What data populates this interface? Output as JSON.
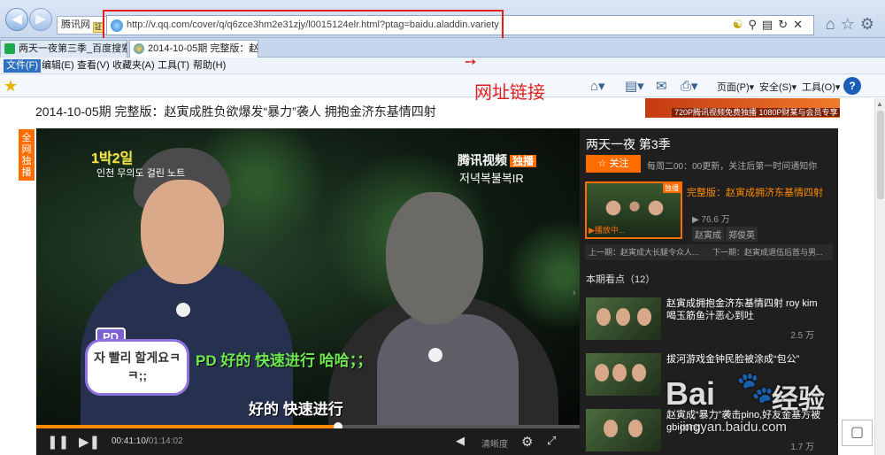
{
  "browser": {
    "site_id": "腾讯网",
    "cert_label": "証",
    "url": "http://v.qq.com/cover/q/q6zce3hm2e31zjy/l0015124elr.html?ptag=baidu.aladdin.variety",
    "tabs": [
      {
        "label": "两天一夜第三季_百度搜索"
      },
      {
        "label": "2014-10-05期 完整版：赵..."
      }
    ],
    "menu": [
      "文件(F)",
      "编辑(E)",
      "查看(V)",
      "收藏夹(A)",
      "工具(T)",
      "帮助(H)"
    ],
    "command_bar": {
      "page": "页面(P)",
      "safety": "安全(S)",
      "tools": "工具(O)"
    },
    "annotation_label": "网址链接"
  },
  "page": {
    "title": "2014-10-05期 完整版：赵寅成胜负欲爆发“暴力”袭人 拥抱金济东基情四射",
    "ad_text": "720P腾讯视频免费独播 1080P财某与会员专享",
    "exclusive_badge": "全网独播"
  },
  "video": {
    "watermark_kr": "1박2일",
    "watermark_kr2": "인천 무의도 걸린 노트",
    "tx_logo": "腾讯视频",
    "tx_exclusive": "独播",
    "tx_sub": "저녁복불복IR",
    "pd_tag": "PD",
    "speech_text": "자 빨리 할게요ㅋㅋ;;",
    "subtitle_pd": "PD 好的 快速进行 哈哈；；",
    "subtitle_main": "好的 快速进行",
    "current_time": "00:41:10",
    "duration": "01:14:02",
    "progress": 0.556,
    "quality_label": "清晰度"
  },
  "side": {
    "show_title": "两天一夜 第3季",
    "follow_label": "关注",
    "schedule": "每周二00：00更新，关注后第一时间通知你",
    "current": {
      "exclusive": "独播",
      "playing": "播放中...",
      "title": "完整版：赵寅成拥济东基情四射",
      "views": "76.6 万",
      "tags": [
        "赵寅成",
        "郑俊英"
      ]
    },
    "prev": "上一期：赵寅成大长腿令众人...",
    "next": "下一期：赵寅成退伍后首与男...",
    "rec_header": "本期看点（12）",
    "recs": [
      {
        "title": "赵寅成拥抱金济东基情四射 roy kim喝玉筋鱼汁恶心到吐",
        "views": "2.5 万"
      },
      {
        "title": "拔河游戏金钟民脸被涂成“包公”",
        "views": ""
      },
      {
        "title": "赵寅成“暴力”袭击pino,好友金基方被gbicong",
        "views": "1.7 万"
      }
    ]
  },
  "watermark": {
    "brand": "Bai",
    "paw": "🐾",
    "brand2": "经验",
    "domain": "jingyan.baidu.com"
  }
}
